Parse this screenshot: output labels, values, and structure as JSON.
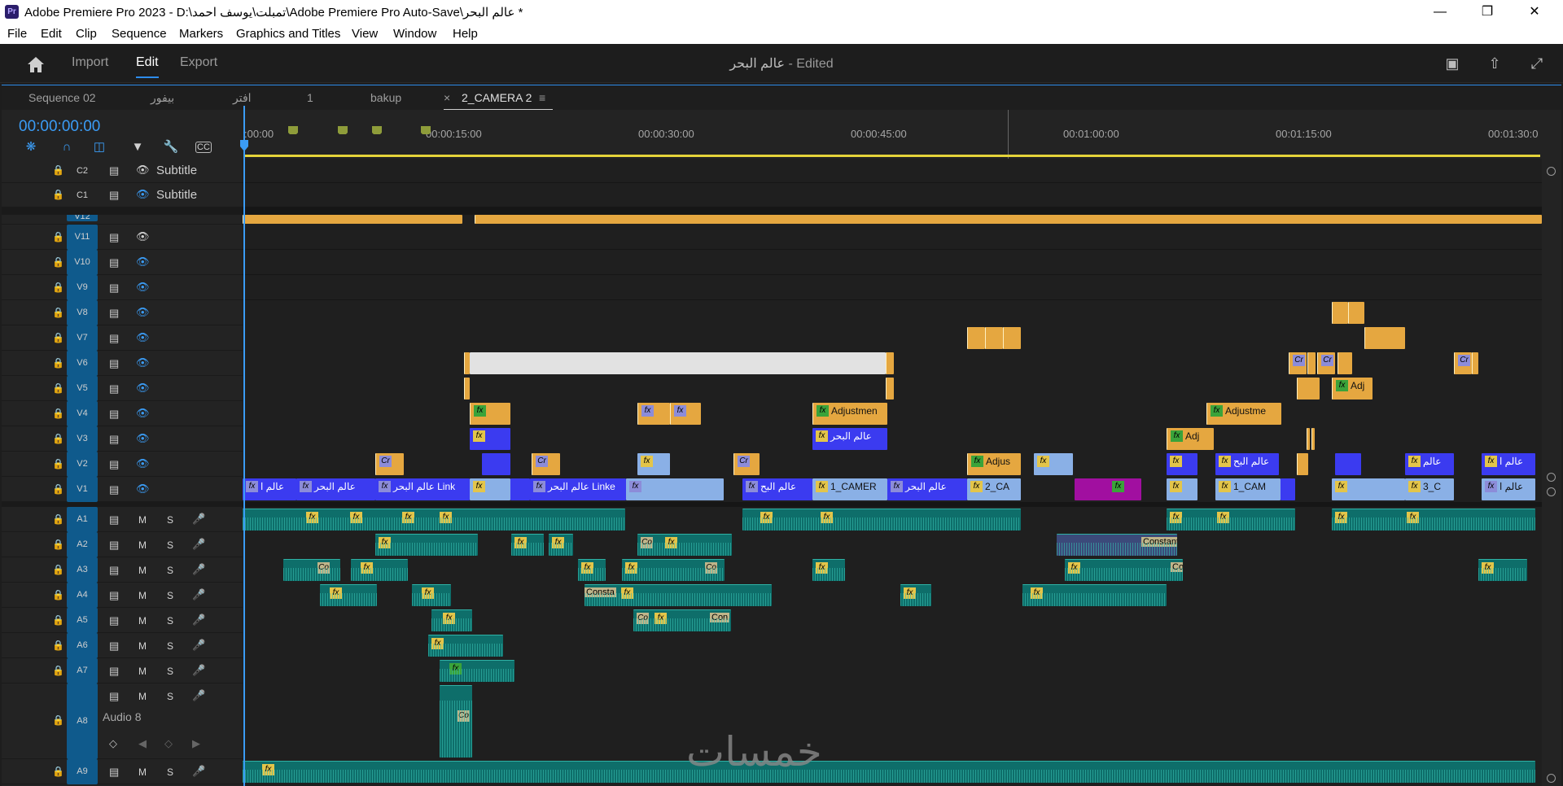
{
  "window": {
    "title": "Adobe Premiere Pro 2023 - D:\\تمبلت\\يوسف احمد\\Adobe Premiere Pro Auto-Save\\عالم البحر *",
    "logo": "Pr"
  },
  "menu": [
    "File",
    "Edit",
    "Clip",
    "Sequence",
    "Markers",
    "Graphics and Titles",
    "View",
    "Window",
    "Help"
  ],
  "workspace": {
    "tabs": [
      "Import",
      "Edit",
      "Export"
    ],
    "active": "Edit",
    "project_name": "عالم البحر",
    "status": "- Edited"
  },
  "sequence_tabs": [
    "Sequence 02",
    "بيفور",
    "افتر",
    "1",
    "bakup",
    "2_CAMERA 2"
  ],
  "active_sequence": "2_CAMERA 2",
  "timecode": "00:00:00:00",
  "ruler": [
    ":00:00",
    "00:00:15:00",
    "00:00:30:00",
    "00:00:45:00",
    "00:01:00:00",
    "00:01:15:00",
    "00:01:30:0"
  ],
  "subtitle_tracks": [
    {
      "name": "C2",
      "label": "Subtitle"
    },
    {
      "name": "C1",
      "label": "Subtitle"
    }
  ],
  "video_tracks": [
    "V12",
    "V11",
    "V10",
    "V9",
    "V8",
    "V7",
    "V6",
    "V5",
    "V4",
    "V3",
    "V2",
    "V1"
  ],
  "audio_tracks": [
    "A1",
    "A2",
    "A3",
    "A4",
    "A5",
    "A6",
    "A7",
    "A8",
    "A9"
  ],
  "audio8_label": "Audio 8",
  "toggles": {
    "mute": "M",
    "solo": "S"
  },
  "clips": {
    "v1_a": "عالم ا",
    "v1_b": "عالم البحر",
    "v1_c": "عالم البحر Link",
    "v1_d": "عالم البحر Linke",
    "v1_e": "عالم البح",
    "v1_f": "1_CAMER",
    "v1_g": "عالم البحر",
    "v1_h": "2_CA",
    "v1_i": "1_CAM",
    "v1_j": "3_C",
    "v1_k": "عالم ا",
    "v4_a": "Adjustmen",
    "v4_b": "Adjustme",
    "v3_a": "عالم البحر",
    "v3_b": "Adj",
    "v2_a": "Adjus",
    "v2_b": "عالم البح",
    "v2_c": "عالم",
    "v2_d": "عالم ا",
    "v5_a": "Adj",
    "cr": "Cr",
    "a_const": "Constant",
    "a_consta": "Consta",
    "a_co": "Co",
    "a_con": "Con"
  },
  "watermark": "خمسات",
  "colors": {
    "accent": "#2d8ceb",
    "timecode": "#3b9cf5",
    "clip_orange": "#e5a740",
    "clip_blue": "#3b3bf0",
    "audio": "#0e6e6a"
  }
}
